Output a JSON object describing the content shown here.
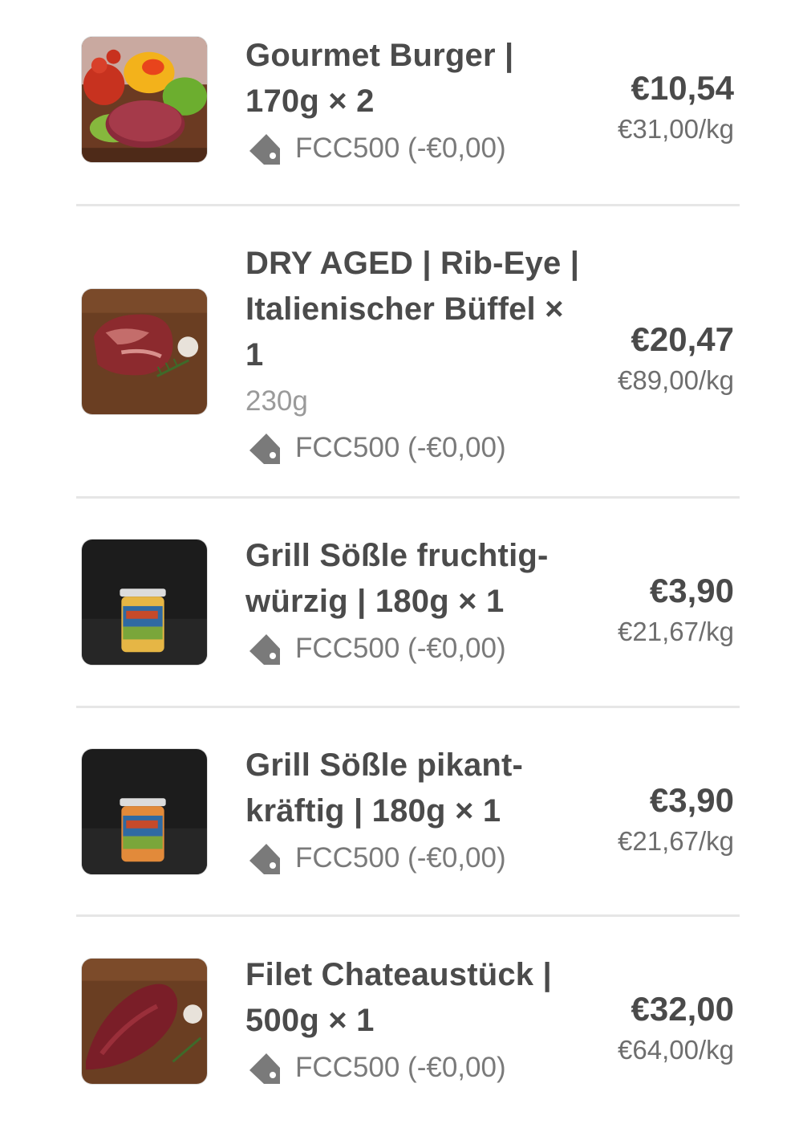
{
  "items": [
    {
      "name": "Gourmet Burger | 170g × 2",
      "variant": "",
      "coupon": "FCC500 (-€0,00)",
      "price": "€10,54",
      "unit_price": "€31,00/kg",
      "image_icon": "burger-patty-image"
    },
    {
      "name": "DRY AGED | Rib-Eye | Italienischer Büffel × 1",
      "variant": "230g",
      "coupon": "FCC500 (-€0,00)",
      "price": "€20,47",
      "unit_price": "€89,00/kg",
      "image_icon": "ribeye-steak-image"
    },
    {
      "name": "Grill Sößle fruchtig-würzig | 180g × 1",
      "variant": "",
      "coupon": "FCC500 (-€0,00)",
      "price": "€3,90",
      "unit_price": "€21,67/kg",
      "image_icon": "sauce-jar-image"
    },
    {
      "name": "Grill Sößle pikant-kräftig | 180g × 1",
      "variant": "",
      "coupon": "FCC500 (-€0,00)",
      "price": "€3,90",
      "unit_price": "€21,67/kg",
      "image_icon": "sauce-jar-image"
    },
    {
      "name": "Filet Chateaustück | 500g × 1",
      "variant": "",
      "coupon": "FCC500 (-€0,00)",
      "price": "€32,00",
      "unit_price": "€64,00/kg",
      "image_icon": "filet-steak-image"
    }
  ],
  "colors": {
    "text_primary": "#4b4b4b",
    "text_secondary": "#9a9a9a",
    "tag_icon": "#7a7a7a",
    "divider": "#e6e6e6"
  }
}
